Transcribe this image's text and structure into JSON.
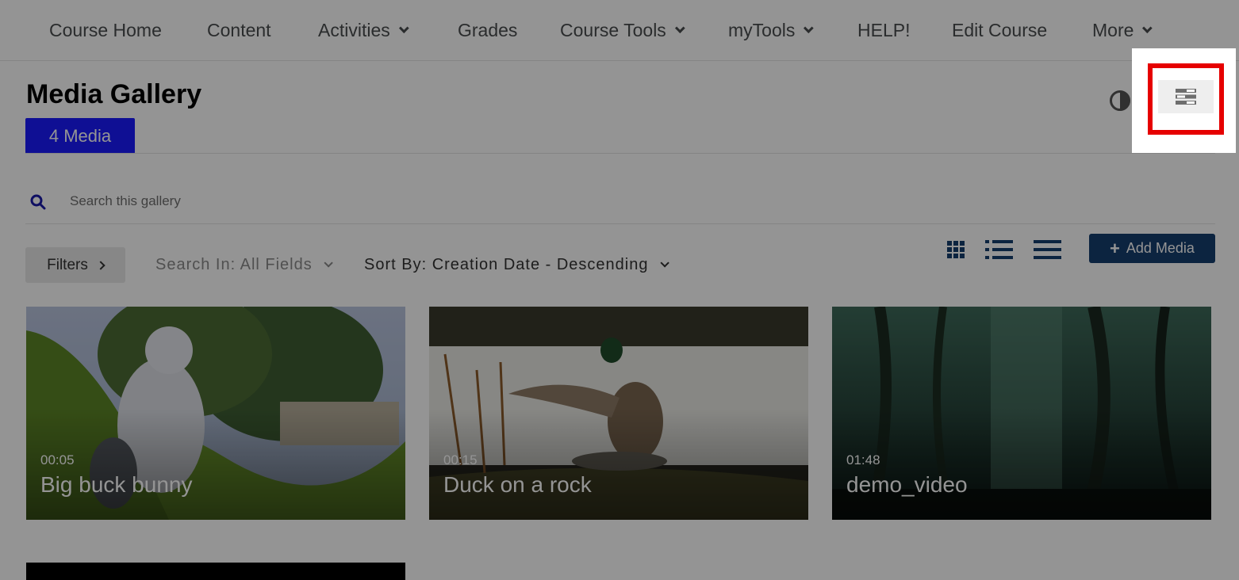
{
  "navbar": {
    "items": [
      {
        "label": "Course Home",
        "dropdown": false
      },
      {
        "label": "Content",
        "dropdown": false
      },
      {
        "label": "Activities",
        "dropdown": true
      },
      {
        "label": "Grades",
        "dropdown": false
      },
      {
        "label": "Course Tools",
        "dropdown": true
      },
      {
        "label": "myTools",
        "dropdown": true
      },
      {
        "label": "HELP!",
        "dropdown": false
      },
      {
        "label": "Edit Course",
        "dropdown": false
      },
      {
        "label": "More",
        "dropdown": true
      }
    ]
  },
  "gallery": {
    "title": "Media Gallery",
    "media_tab_label": "4 Media",
    "contrast_icon": "contrast-icon",
    "menu_icon": "menu-toggle-icon"
  },
  "search": {
    "placeholder": "Search this gallery",
    "value": ""
  },
  "toolbar": {
    "filters_label": "Filters",
    "search_in_label": "Search In: All Fields",
    "sort_by_label": "Sort By: Creation Date - Descending",
    "view_icons": [
      "grid-view-icon",
      "detailed-list-view-icon",
      "compact-list-view-icon"
    ],
    "add_media_label": "Add Media"
  },
  "media": [
    {
      "duration": "00:05",
      "title": "Big buck bunny"
    },
    {
      "duration": "00:15",
      "title": "Duck on a rock"
    },
    {
      "duration": "01:48",
      "title": "demo_video"
    }
  ],
  "colors": {
    "tab_blue": "#1a1aff",
    "add_media_navy": "#163e6e",
    "highlight_red": "#e60000",
    "nav_text": "#494c4e"
  }
}
